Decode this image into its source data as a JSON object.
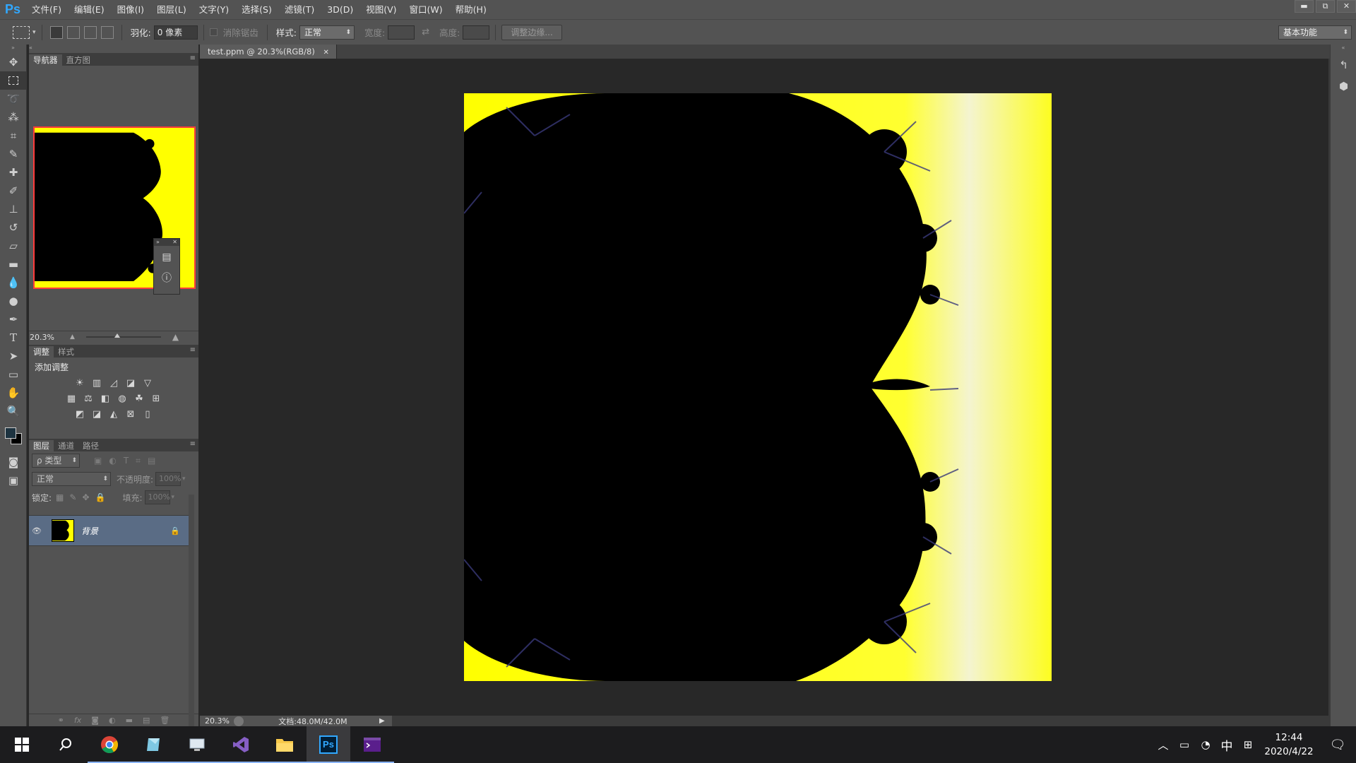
{
  "app": {
    "logo": "Ps"
  },
  "menu": [
    "文件(F)",
    "编辑(E)",
    "图像(I)",
    "图层(L)",
    "文字(Y)",
    "选择(S)",
    "滤镜(T)",
    "3D(D)",
    "视图(V)",
    "窗口(W)",
    "帮助(H)"
  ],
  "window_controls": {
    "minimize": "▬",
    "restore": "⧉",
    "close": "✕"
  },
  "options": {
    "feather_label": "羽化:",
    "feather_value": "0 像素",
    "antialias_label": "消除锯齿",
    "style_label": "样式:",
    "style_value": "正常",
    "width_label": "宽度:",
    "height_label": "高度:",
    "refine_edge": "调整边缘...",
    "workspace": "基本功能"
  },
  "navigator": {
    "tabs": [
      "导航器",
      "直方图"
    ],
    "zoom": "20.3%"
  },
  "adjustments": {
    "tabs": [
      "调整",
      "样式"
    ],
    "add_label": "添加调整"
  },
  "layers": {
    "tabs": [
      "图层",
      "通道",
      "路径"
    ],
    "filter_kind": "ρ 类型",
    "blend_mode": "正常",
    "opacity_label": "不透明度:",
    "opacity_value": "100%",
    "lock_label": "锁定:",
    "fill_label": "填充:",
    "fill_value": "100%",
    "items": [
      {
        "name": "背景",
        "visible": true,
        "locked": true
      }
    ]
  },
  "document": {
    "tab_title": "test.ppm @ 20.3%(RGB/8)",
    "zoom": "20.3%",
    "doc_size": "文档:48.0M/42.0M"
  },
  "colors": {
    "fractal_yellow": "#ffff00",
    "fractal_black": "#000000",
    "selection_red": "#ff3b3b"
  },
  "taskbar": {
    "apps": [
      "windows-start",
      "search",
      "chrome",
      "app-blue",
      "app-remote",
      "visual-studio",
      "file-explorer",
      "photoshop",
      "terminal"
    ],
    "ps_label": "Ps",
    "ime": "中",
    "clock_time": "12:44",
    "clock_date": "2020/4/22"
  }
}
